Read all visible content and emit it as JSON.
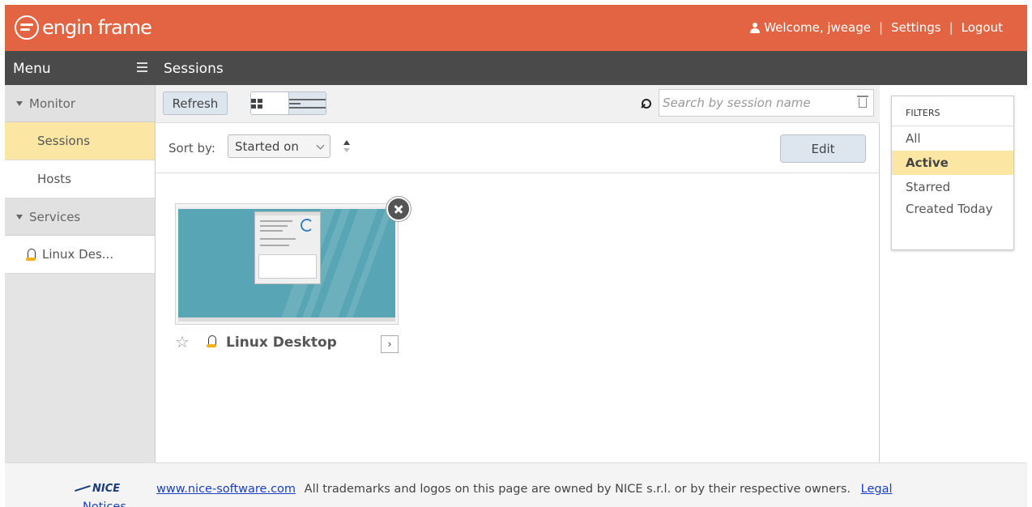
{
  "header": {
    "logo_text": "engin frame",
    "welcome": "Welcome, jweage",
    "settings": "Settings",
    "logout": "Logout",
    "separator": "|",
    "brand_color": "#e36442"
  },
  "menu": {
    "title": "Menu",
    "sections": [
      {
        "label": "Monitor",
        "items": [
          {
            "label": "Sessions",
            "active": true
          },
          {
            "label": "Hosts",
            "active": false
          }
        ]
      },
      {
        "label": "Services",
        "items": [
          {
            "label": "Linux Des..."
          }
        ]
      }
    ]
  },
  "page": {
    "title": "Sessions"
  },
  "toolbar": {
    "refresh": "Refresh",
    "search_placeholder": "Search by session name"
  },
  "sort": {
    "label": "Sort by:",
    "selected": "Started on",
    "edit": "Edit"
  },
  "sessions": [
    {
      "name": "Linux Desktop",
      "starred": false
    }
  ],
  "filters": {
    "heading": "FILTERS",
    "options": [
      {
        "label": "All",
        "active": false
      },
      {
        "label": "Active",
        "active": true
      },
      {
        "label": "Starred",
        "active": false
      },
      {
        "label": "Created Today",
        "active": false
      }
    ]
  },
  "footer": {
    "logo": "NICE",
    "link": "www.nice-software.com",
    "text": "All trademarks and logos on this page are owned by NICE s.r.l. or by their respective owners.",
    "legal_1": "Legal",
    "legal_2": "Notices"
  }
}
